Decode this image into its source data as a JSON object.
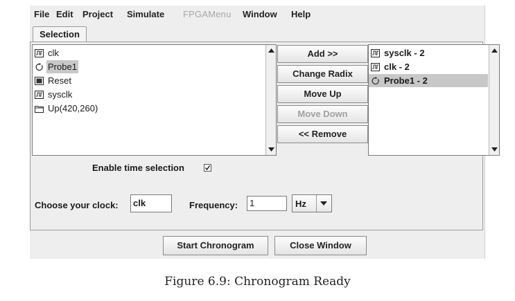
{
  "menu": {
    "file": "File",
    "edit": "Edit",
    "project": "Project",
    "simulate": "Simulate",
    "fpgamenu": "FPGAMenu",
    "window": "Window",
    "help": "Help"
  },
  "tab": {
    "label": "Selection"
  },
  "available_signals": [
    {
      "label": "clk",
      "icon": "clock-signal-icon",
      "selected": false
    },
    {
      "label": "Probe1",
      "icon": "probe-icon",
      "selected": true
    },
    {
      "label": "Reset",
      "icon": "reset-block-icon",
      "selected": false
    },
    {
      "label": "sysclk",
      "icon": "clock-signal-icon",
      "selected": false
    },
    {
      "label": "Up(420,260)",
      "icon": "folder-icon",
      "selected": false
    }
  ],
  "buttons": {
    "add": "Add >>",
    "change_radix": "Change Radix",
    "move_up": "Move Up",
    "move_down": "Move Down",
    "remove": "<< Remove"
  },
  "selected_signals": [
    {
      "label": "sysclk - 2",
      "icon": "clock-signal-icon",
      "selected": false
    },
    {
      "label": "clk - 2",
      "icon": "clock-signal-icon",
      "selected": false
    },
    {
      "label": "Probe1 - 2",
      "icon": "probe-icon",
      "selected": true
    }
  ],
  "time_selection": {
    "label": "Enable time selection",
    "checked": true
  },
  "clock": {
    "label": "Choose your clock:",
    "value": "clk"
  },
  "frequency": {
    "label": "Frequency:",
    "value": "1",
    "unit": "Hz"
  },
  "footer": {
    "start_chronogram": "Start Chronogram",
    "close_window": "Close Window"
  },
  "caption": "Figure 6.9: Chronogram Ready"
}
